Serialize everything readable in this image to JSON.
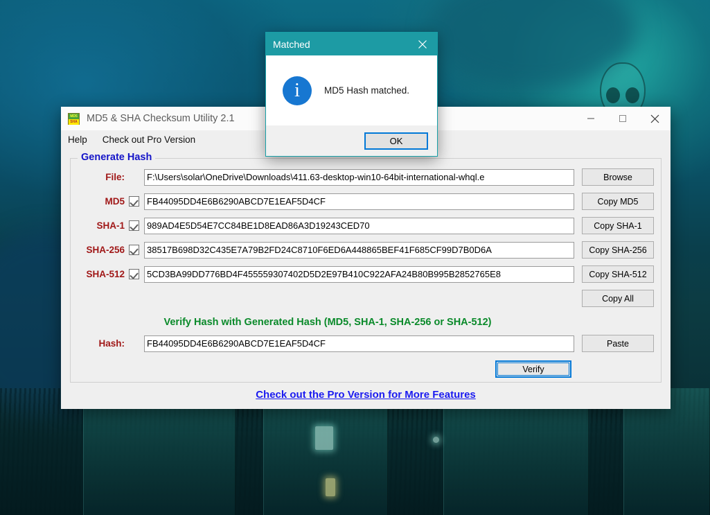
{
  "desktop": {
    "wallpaper_hint": "dark teal sci-fi armor wallpaper"
  },
  "window": {
    "title": "MD5 & SHA Checksum Utility 2.1",
    "icon_top_text": "MD5",
    "icon_bottom_text": "SHA",
    "controls": {
      "minimize": "minimize-icon",
      "maximize": "maximize-icon",
      "close": "close-icon"
    },
    "menu": [
      {
        "label": "Help"
      },
      {
        "label": "Check out Pro Version"
      }
    ]
  },
  "generate_group": {
    "legend": "Generate Hash",
    "legend_color": "#1414c8",
    "file_row": {
      "label": "File:",
      "value": "F:\\Users\\solar\\OneDrive\\Downloads\\411.63-desktop-win10-64bit-international-whql.e",
      "button": "Browse"
    },
    "hash_rows": [
      {
        "label": "MD5",
        "checked": true,
        "value": "FB44095DD4E6B6290ABCD7E1EAF5D4CF",
        "button": "Copy MD5"
      },
      {
        "label": "SHA-1",
        "checked": true,
        "value": "989AD4E5D54E7CC84BE1D8EAD86A3D19243CED70",
        "button": "Copy SHA-1"
      },
      {
        "label": "SHA-256",
        "checked": true,
        "value": "38517B698D32C435E7A79B2FD24C8710F6ED6A448865BEF41F685CF99D7B0D6A",
        "button": "Copy SHA-256"
      },
      {
        "label": "SHA-512",
        "checked": true,
        "value": "5CD3BA99DD776BD4F455559307402D5D2E97B410C922AFA24B80B995B2852765E8",
        "button": "Copy SHA-512"
      }
    ],
    "copy_all_button": "Copy All"
  },
  "verify_group": {
    "title": "Verify Hash with Generated Hash (MD5, SHA-1, SHA-256 or SHA-512)",
    "title_color": "#0a8a2a",
    "hash_label": "Hash:",
    "hash_value": "FB44095DD4E6B6290ABCD7E1EAF5D4CF",
    "paste_button": "Paste",
    "verify_button": "Verify"
  },
  "footer": {
    "pro_link": "Check out the Pro Version for More Features",
    "pro_link_color": "#1a1af0"
  },
  "dialog": {
    "title": "Matched",
    "titlebar_color": "#1d9ba4",
    "close_icon": "close-icon",
    "icon": "info-icon",
    "icon_glyph": "i",
    "message": "MD5 Hash matched.",
    "ok_button": "OK"
  }
}
